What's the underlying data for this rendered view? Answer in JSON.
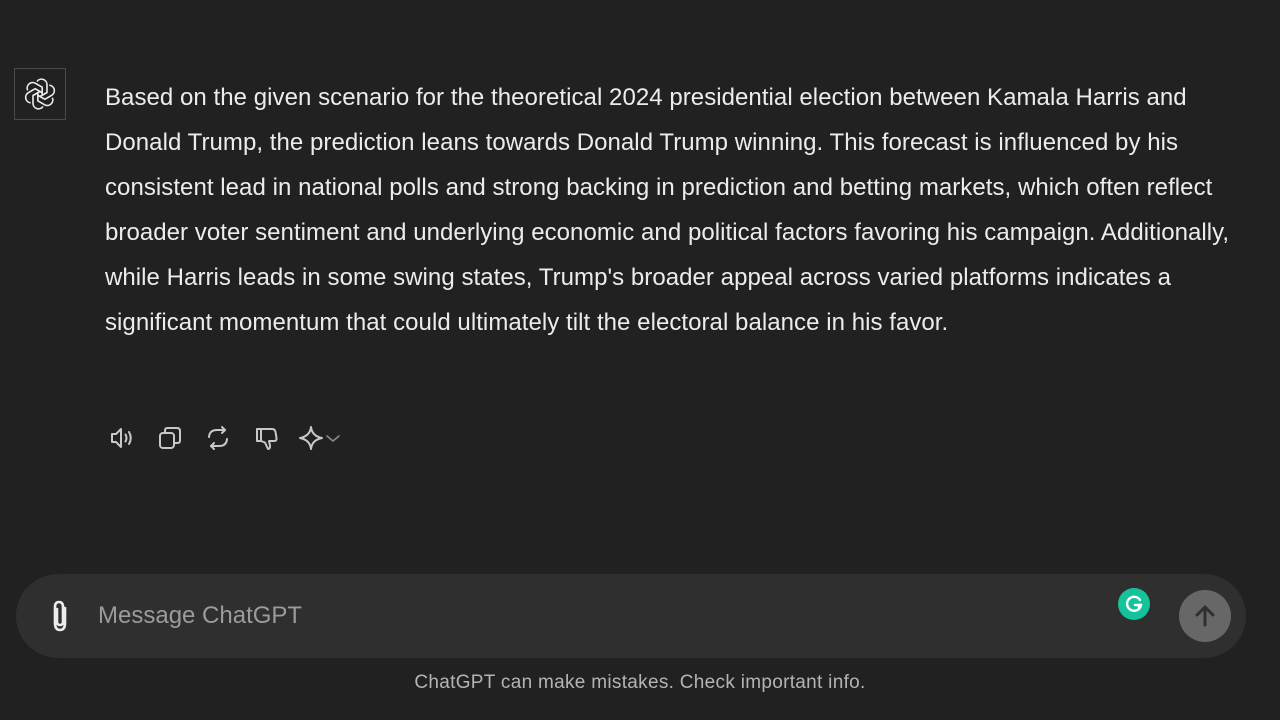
{
  "conversation": {
    "assistant_avatar_icon": "openai-logo-icon",
    "response_text": "Based on the given scenario for the theoretical 2024 presidential election between Kamala Harris and Donald Trump, the prediction leans towards Donald Trump winning. This forecast is influenced by his consistent lead in national polls and strong backing in prediction and betting markets, which often reflect broader voter sentiment and underlying economic and political factors favoring his campaign. Additionally, while Harris leads in some swing states, Trump's broader appeal across varied platforms indicates a significant momentum that could ultimately tilt the electoral balance in his favor."
  },
  "message_actions": [
    {
      "icon": "speaker-icon"
    },
    {
      "icon": "copy-icon"
    },
    {
      "icon": "regenerate-icon"
    },
    {
      "icon": "thumbs-down-icon"
    },
    {
      "icon": "sparkle-icon",
      "secondary_icon": "chevron-down-icon"
    }
  ],
  "composer": {
    "placeholder": "Message ChatGPT",
    "value": "",
    "attach_icon": "paperclip-icon",
    "extension_icon": "grammarly-icon",
    "send_icon": "arrow-up-icon"
  },
  "footer": {
    "disclaimer": "ChatGPT can make mistakes. Check important info."
  },
  "colors": {
    "background": "#212121",
    "composer_background": "#2f2f2f",
    "text": "#ececec",
    "muted_text": "#b4b4b4",
    "grammarly_green": "#15c39a",
    "send_button": "#676767"
  }
}
